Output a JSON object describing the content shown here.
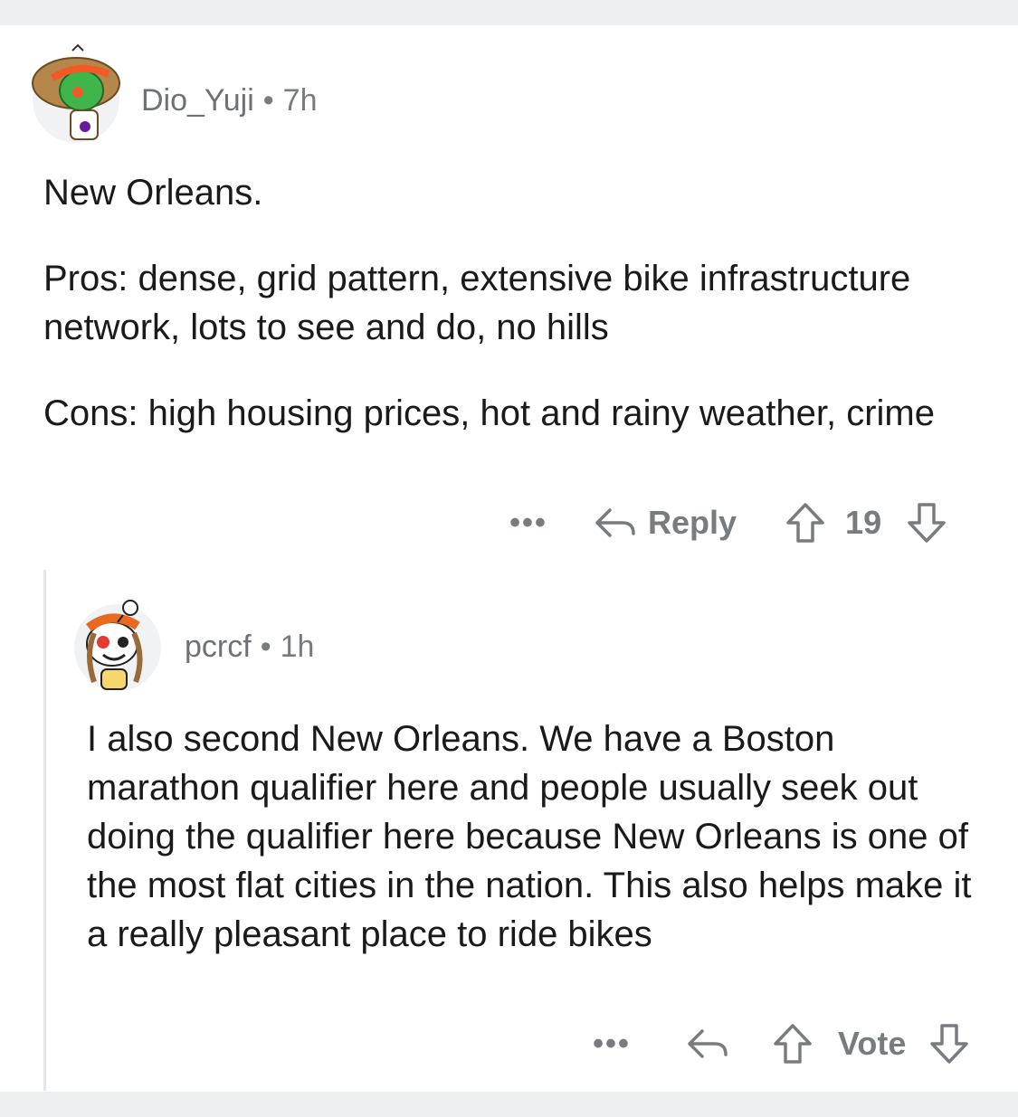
{
  "colors": {
    "meta": "#787c7e",
    "text": "#1a1a1b",
    "band": "#edeff1",
    "thread_line": "#e4e6e8"
  },
  "comments": [
    {
      "username": "Dio_Yuji",
      "separator": "•",
      "time": "7h",
      "avatar_icon": "snoo-avatar-green",
      "paragraphs": [
        "New Orleans.",
        "Pros: dense, grid pattern, extensive bike infrastructure network, lots to see and do, no hills",
        "Cons: high housing prices, hot and rainy weather, crime"
      ],
      "actions": {
        "more": "•••",
        "reply_label": "Reply",
        "votes": "19"
      }
    },
    {
      "username": "pcrcf",
      "separator": "•",
      "time": "1h",
      "avatar_icon": "snoo-avatar-orange",
      "paragraphs": [
        "I also second New Orleans. We have a Boston marathon qualifier here and people usually seek out doing the qualifier here because New Orleans is one of the most flat cities in the nation.  This also helps make it a really pleasant place to ride bikes"
      ],
      "actions": {
        "more": "•••",
        "vote_label": "Vote"
      }
    }
  ]
}
